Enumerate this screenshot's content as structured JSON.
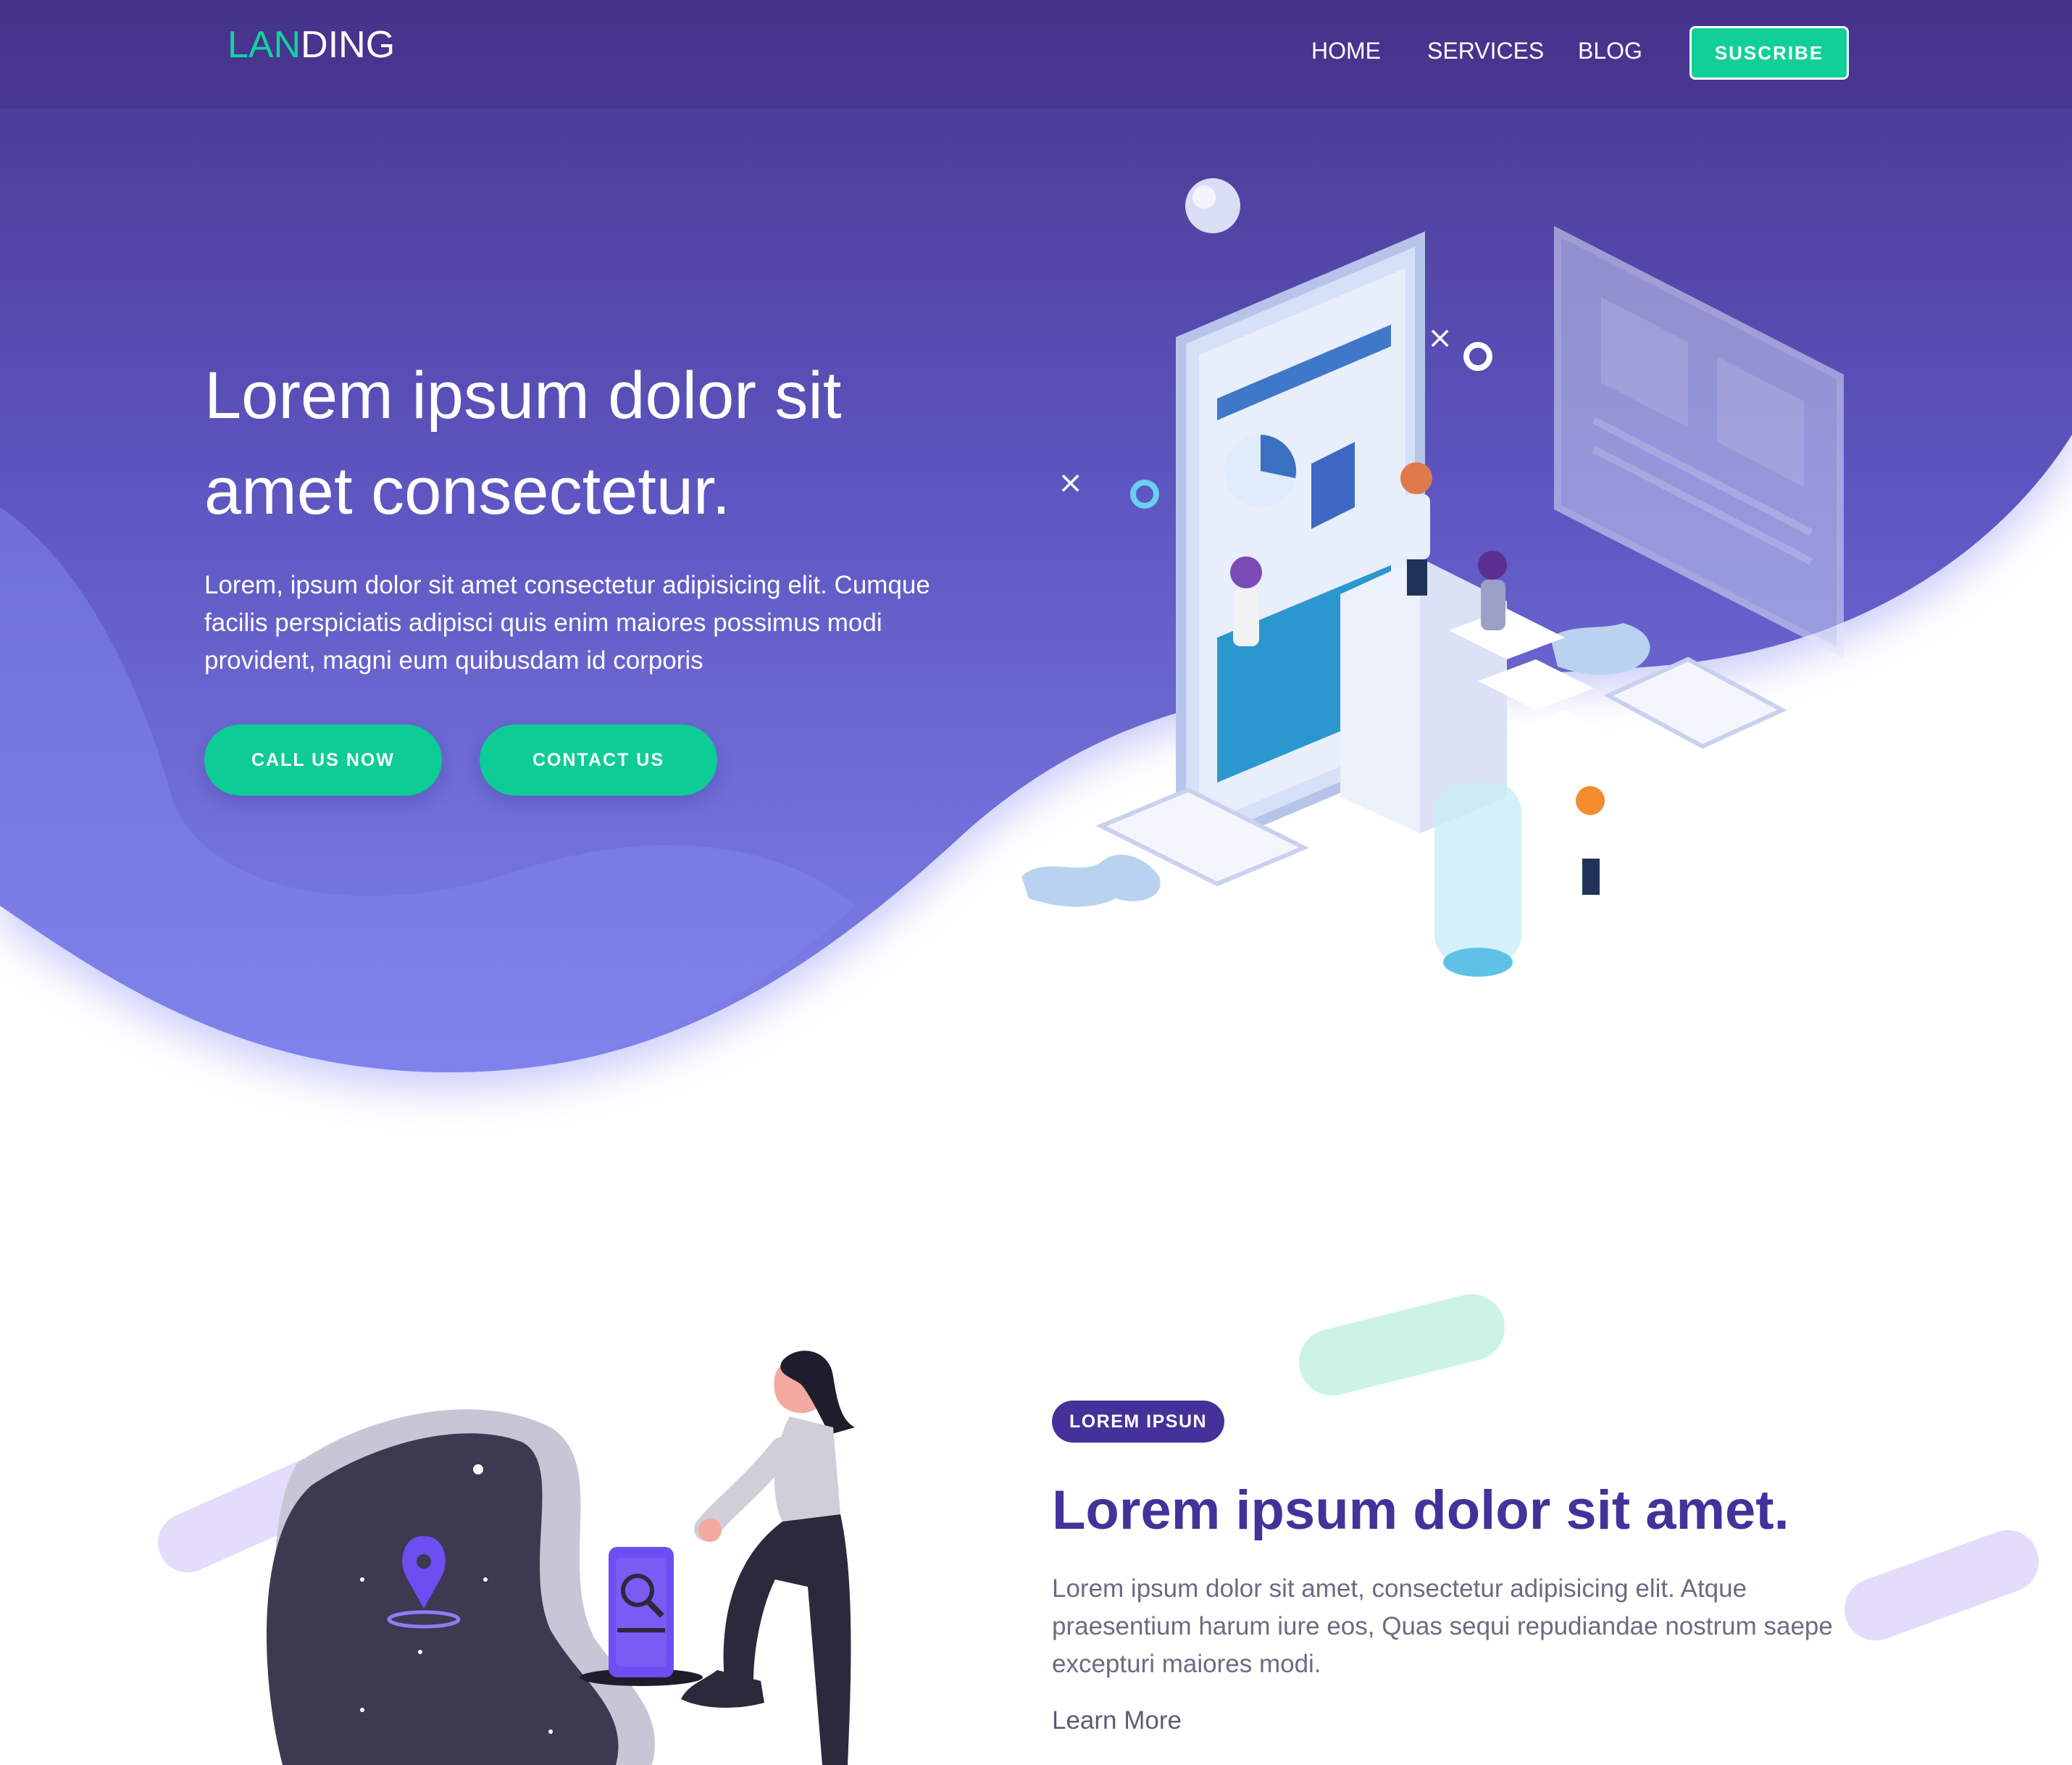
{
  "nav": {
    "logo_accent": "LAN",
    "logo_rest": "DING",
    "links": [
      "HOME",
      "SERVICES",
      "BLOG"
    ],
    "subscribe_label": "SUSCRIBE"
  },
  "hero": {
    "title_line1": "Lorem ipsum dolor sit",
    "title_line2": "amet consectetur.",
    "text": "Lorem, ipsum dolor sit amet consectetur adipisicing elit. Cumque facilis perspiciatis adipisci quis enim maiores possimus modi provident, magni eum quibusdam id corporis",
    "buttons": {
      "call": "CALL US NOW",
      "contact": "CONTACT US"
    }
  },
  "section": {
    "badge": "LOREM IPSUN",
    "title": "Lorem ipsum dolor sit amet.",
    "text": "Lorem ipsum dolor sit amet, consectetur adipisicing elit. Atque praesentium harum iure eos, Quas sequi repudiandae nostrum saepe excepturi maiores modi.",
    "link": "Learn More"
  },
  "colors": {
    "header": "#45318a",
    "gradient_top": "#48388e",
    "gradient_bottom": "#7b7fe6",
    "accent_green": "#0dcc96",
    "heading_purple": "#44329a"
  },
  "icons": [
    "map-pin-icon",
    "magnifier-icon"
  ]
}
